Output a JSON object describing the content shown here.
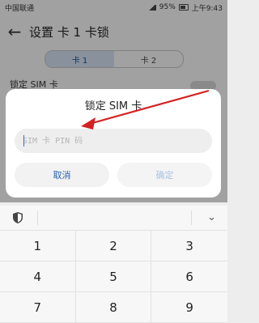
{
  "status_bar": {
    "carrier": "中国联通",
    "battery": "95%",
    "time": "上午9:43"
  },
  "header": {
    "title": "设置 卡 1 卡锁"
  },
  "tabs": [
    {
      "label": "卡 1",
      "active": true
    },
    {
      "label": "卡 2",
      "active": false
    }
  ],
  "background_settings": {
    "lock_sim_label": "锁定 SIM 卡"
  },
  "dialog": {
    "title": "锁定 SIM 卡",
    "pin_placeholder": "SIM 卡 PIN 码",
    "pin_value": "",
    "cancel_label": "取消",
    "confirm_label": "确定"
  },
  "annotation": {
    "color": "#d32222"
  },
  "keyboard": {
    "icons": {
      "shield": "shield-icon",
      "collapse": "chevron-down-icon"
    },
    "keys": [
      "1",
      "2",
      "3",
      "4",
      "5",
      "6",
      "7",
      "8",
      "9"
    ]
  },
  "colors": {
    "accent": "#2a62b3",
    "tab_active_bg": "#c9d6e6"
  }
}
